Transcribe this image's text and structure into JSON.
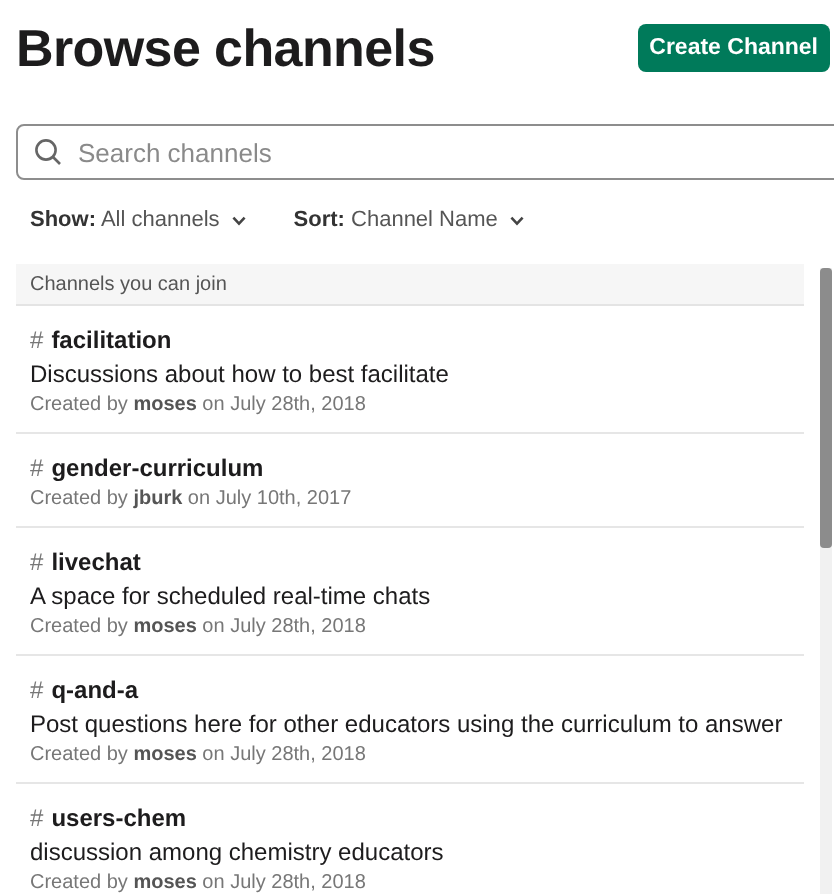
{
  "title": "Browse channels",
  "create_button": "Create Channel",
  "search": {
    "placeholder": "Search channels"
  },
  "filters": [
    {
      "label": "Show:",
      "value": "All channels"
    },
    {
      "label": "Sort:",
      "value": "Channel Name"
    }
  ],
  "section": {
    "title": "Channels you can join",
    "channels": [
      {
        "hash": "#",
        "name": "facilitation",
        "description": "Discussions about how to best facilitate",
        "created": "Created by **moses** on July 28th, 2018"
      },
      {
        "hash": "#",
        "name": "gender-curriculum",
        "created": "Created by **jburk** on July 10th, 2017"
      },
      {
        "hash": "#",
        "name": "livechat",
        "description": "A space for scheduled real-time chats",
        "created": "Created by **moses** on July 28th, 2018"
      },
      {
        "hash": "#",
        "name": "q-and-a",
        "description": "Post questions here for other educators using the curriculum to answer",
        "created": "Created by **moses** on July 28th, 2018"
      },
      {
        "hash": "#",
        "name": "users-chem",
        "description": "discussion among chemistry educators",
        "created": "Created by **moses** on July 28th, 2018"
      }
    ]
  }
}
